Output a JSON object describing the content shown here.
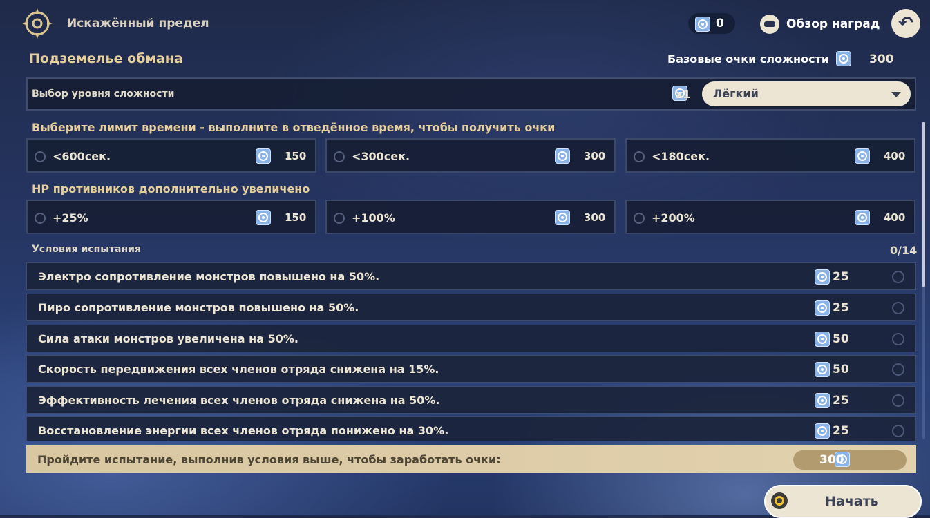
{
  "header": {
    "title": "Искажённый предел",
    "currency_value": "0",
    "reward_overview_label": "Обзор наград"
  },
  "dungeon": {
    "title": "Подземелье обмана",
    "base_points_label": "Базовые очки сложности",
    "base_points_value": "300"
  },
  "difficulty": {
    "label": "Выбор уровня сложности",
    "multiplier": "x1",
    "selected": "Лёгкий"
  },
  "time_limit": {
    "title": "Выберите лимит времени - выполните в отведённое время, чтобы получить очки",
    "options": [
      {
        "label": "<600сек.",
        "points": "150"
      },
      {
        "label": "<300сек.",
        "points": "300"
      },
      {
        "label": "<180сек.",
        "points": "400"
      }
    ]
  },
  "enemy_hp": {
    "title": "HP противников дополнительно увеличено",
    "options": [
      {
        "label": "+25%",
        "points": "150"
      },
      {
        "label": "+100%",
        "points": "300"
      },
      {
        "label": "+200%",
        "points": "400"
      }
    ]
  },
  "conditions": {
    "title": "Условия испытания",
    "count": "0/14",
    "items": [
      {
        "label": "Электро сопротивление монстров повышено на 50%.",
        "points": "25"
      },
      {
        "label": "Пиро сопротивление монстров повышено на 50%.",
        "points": "25"
      },
      {
        "label": "Сила атаки монстров увеличена на 50%.",
        "points": "50"
      },
      {
        "label": "Скорость передвижения всех членов отряда снижена на 15%.",
        "points": "50"
      },
      {
        "label": "Эффективность лечения всех членов отряда снижена на 50%.",
        "points": "25"
      },
      {
        "label": "Восстановление энергии всех членов отряда понижено на 30%.",
        "points": "25"
      }
    ]
  },
  "total": {
    "label": "Пройдите испытание, выполнив условия выше, чтобы заработать очки:",
    "value": "300"
  },
  "start_button": {
    "label": "Начать"
  },
  "colors": {
    "accent_gold": "#e6cf9a",
    "panel_dark": "#161e34",
    "cream": "#ece5d3",
    "point_icon": "#8ab3e8"
  }
}
